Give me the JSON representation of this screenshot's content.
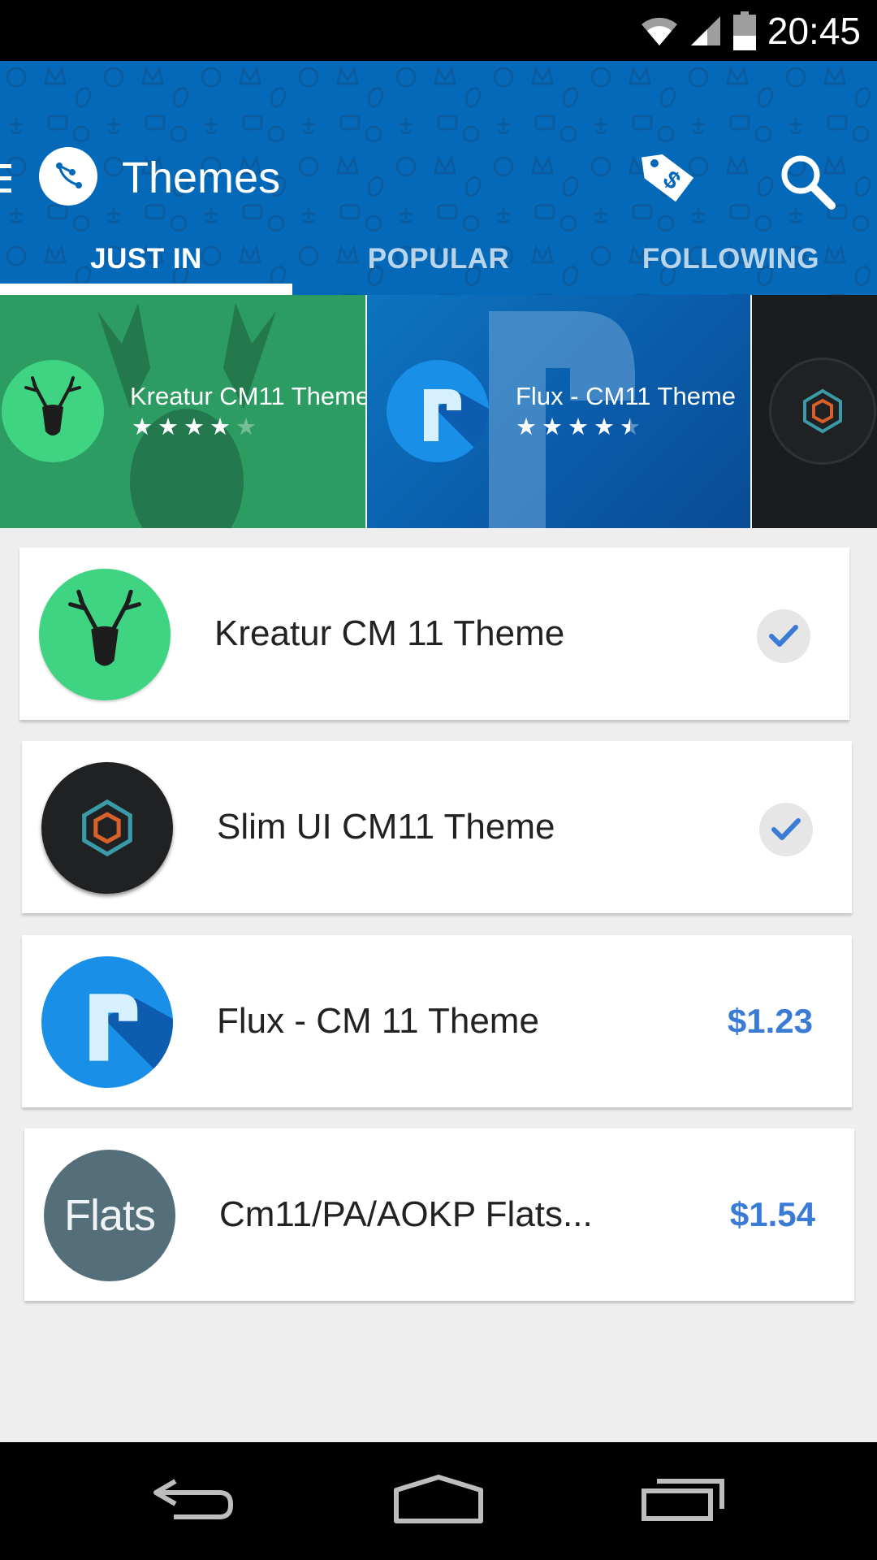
{
  "status_bar": {
    "time": "20:45",
    "icons": [
      "wifi-icon",
      "signal-icon",
      "battery-icon"
    ]
  },
  "app_bar": {
    "title": "Themes",
    "icons": [
      "menu-icon",
      "app-logo-icon",
      "price-tag-icon",
      "search-icon"
    ]
  },
  "tabs": [
    {
      "label": "JUST IN",
      "active": true
    },
    {
      "label": "POPULAR",
      "active": false
    },
    {
      "label": "FOLLOWING",
      "active": false
    }
  ],
  "featured": [
    {
      "title": "Kreatur CM11 Theme",
      "rating": 4,
      "icon": "deer-skull-icon"
    },
    {
      "title": "Flux - CM11 Theme",
      "rating": 4.5,
      "icon": "flux-logo-icon"
    },
    {
      "title": "",
      "rating": null,
      "icon": "slim-hexagon-icon"
    }
  ],
  "themes": [
    {
      "title": "Kreatur CM 11 Theme",
      "status": "installed",
      "icon": "deer-skull-icon"
    },
    {
      "title": "Slim UI CM11 Theme",
      "status": "installed",
      "icon": "slim-hexagon-icon"
    },
    {
      "title": "Flux - CM 11 Theme",
      "price": "$1.23",
      "icon": "flux-logo-icon"
    },
    {
      "title": "Cm11/PA/AOKP Flats...",
      "price": "$1.54",
      "icon": "flats-logo-icon",
      "icon_text": "Flats"
    }
  ],
  "nav_bar": {
    "icons": [
      "back-icon",
      "home-icon",
      "recents-icon"
    ]
  },
  "colors": {
    "app_bar": "#0569b9",
    "price": "#3a7bd5",
    "kreatur_green": "#3fd482",
    "flux_blue": "#1a8fe8",
    "flats_gray": "#546e7a"
  }
}
